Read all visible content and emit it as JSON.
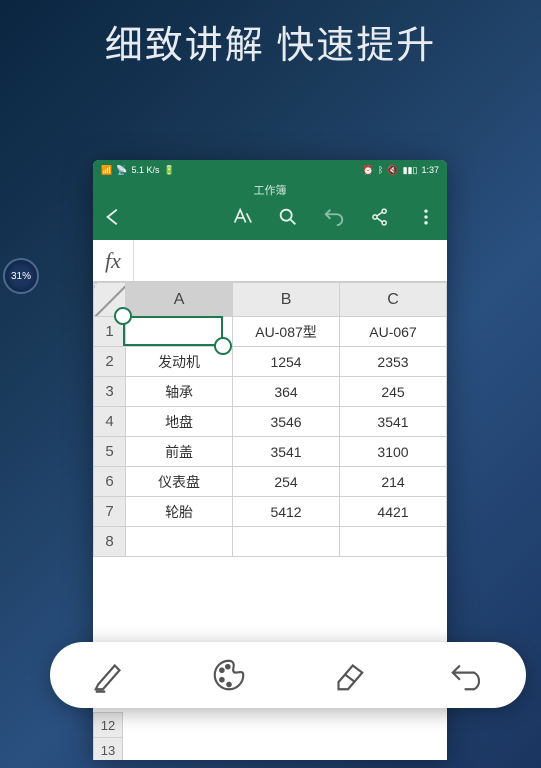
{
  "title": "细致讲解 快速提升",
  "badge": "31%",
  "statusbar": {
    "left": "5.1 K/s",
    "right": "1:37"
  },
  "doc_title": "工作簿",
  "fx_label": "fx",
  "columns": [
    "A",
    "B",
    "C"
  ],
  "rows": [
    {
      "n": "1",
      "a": "",
      "b": "AU-087型",
      "c": "AU-067"
    },
    {
      "n": "2",
      "a": "发动机",
      "b": "1254",
      "c": "2353"
    },
    {
      "n": "3",
      "a": "轴承",
      "b": "364",
      "c": "245"
    },
    {
      "n": "4",
      "a": "地盘",
      "b": "3546",
      "c": "3541"
    },
    {
      "n": "5",
      "a": "前盖",
      "b": "3541",
      "c": "3100"
    },
    {
      "n": "6",
      "a": "仪表盘",
      "b": "254",
      "c": "214"
    },
    {
      "n": "7",
      "a": "轮胎",
      "b": "5412",
      "c": "4421"
    },
    {
      "n": "8",
      "a": "",
      "b": "",
      "c": ""
    }
  ],
  "extra_rows": [
    "12",
    "13"
  ],
  "chart_data": {
    "type": "table",
    "columns": [
      "",
      "AU-087型",
      "AU-067"
    ],
    "rows": [
      [
        "发动机",
        1254,
        2353
      ],
      [
        "轴承",
        364,
        245
      ],
      [
        "地盘",
        3546,
        3541
      ],
      [
        "前盖",
        3541,
        3100
      ],
      [
        "仪表盘",
        254,
        214
      ],
      [
        "轮胎",
        5412,
        4421
      ]
    ]
  }
}
